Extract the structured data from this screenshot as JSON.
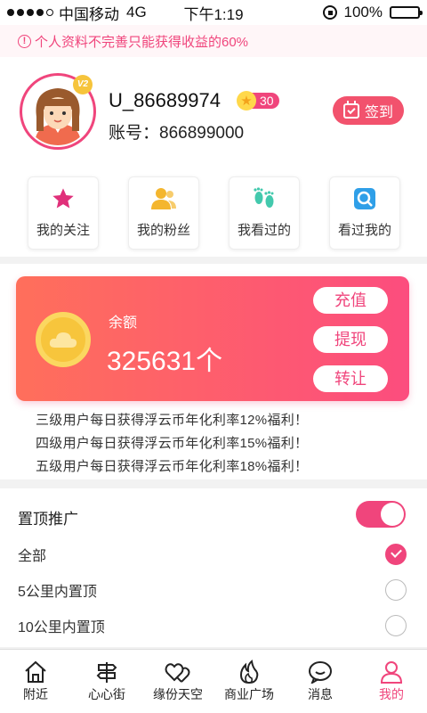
{
  "status_bar": {
    "carrier": "中国移动",
    "network": "4G",
    "time": "下午1:19",
    "battery": "100%"
  },
  "notice": {
    "text": "个人资料不完善只能获得收益的60%",
    "icon": "warning-icon"
  },
  "profile": {
    "vip_badge": "V2",
    "username": "U_86689974",
    "level": "30",
    "account_label": "账号：",
    "account_number": "866899000",
    "checkin_label": "签到"
  },
  "quick_actions": [
    {
      "label": "我的关注",
      "icon": "star-icon",
      "color": "#e0307a"
    },
    {
      "label": "我的粉丝",
      "icon": "users-icon",
      "color": "#f4b62e"
    },
    {
      "label": "我看过的",
      "icon": "footprints-icon",
      "color": "#43c9ad"
    },
    {
      "label": "看过我的",
      "icon": "search-icon",
      "color": "#2f9fe8"
    }
  ],
  "wallet": {
    "balance_label": "余额",
    "balance": "325631个",
    "buttons": [
      "充值",
      "提现",
      "转让"
    ],
    "gradient": [
      "#ff6f5b",
      "#fc4d7e"
    ]
  },
  "bonus_lines": [
    "三级用户每日获得浮云币年化利率12%福利！",
    "四级用户每日获得浮云币年化利率15%福利！",
    "五级用户每日获得浮云币年化利率18%福利！"
  ],
  "promotion": {
    "title": "置顶推广",
    "enabled": true,
    "options": [
      {
        "label": "全部",
        "selected": true
      },
      {
        "label": "5公里内置顶",
        "selected": false
      },
      {
        "label": "10公里内置顶",
        "selected": false
      }
    ]
  },
  "tabbar": {
    "active": 5,
    "tabs": [
      {
        "label": "附近",
        "icon": "home-icon"
      },
      {
        "label": "心心街",
        "icon": "signpost-icon"
      },
      {
        "label": "缘份天空",
        "icon": "hearts-icon"
      },
      {
        "label": "商业广场",
        "icon": "flame-icon"
      },
      {
        "label": "消息",
        "icon": "chat-icon"
      },
      {
        "label": "我的",
        "icon": "person-icon"
      }
    ]
  },
  "accent_color": "#f0457c"
}
